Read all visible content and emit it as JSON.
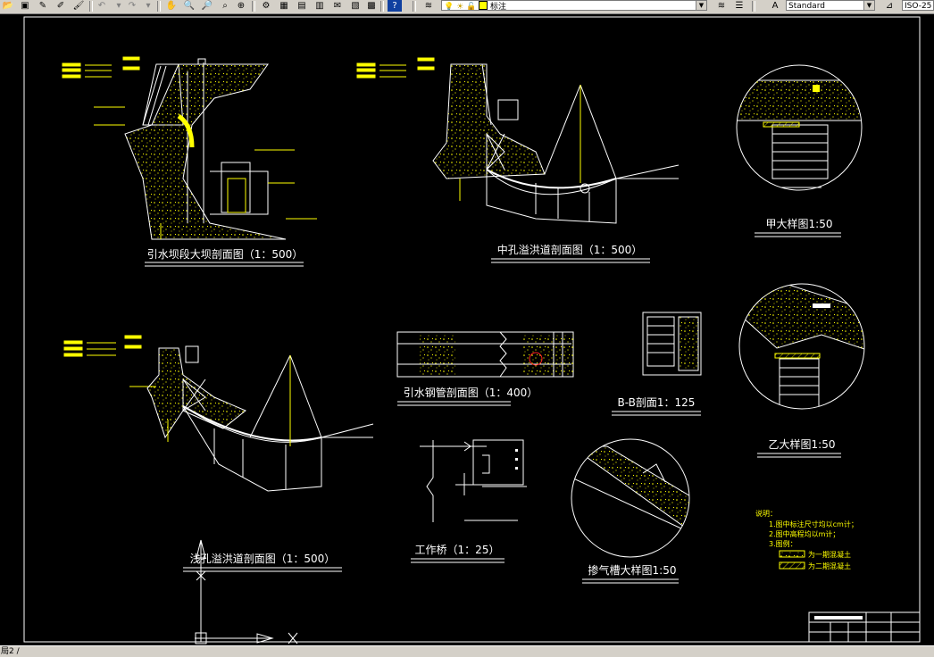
{
  "toolbar": {
    "layer_value": "标注",
    "text_style_value": "Standard",
    "dim_style_value": "ISO-25",
    "icons": [
      "open-icon",
      "save-icon",
      "pencil-icon",
      "match-icon",
      "undo-icon",
      "redo-icon",
      "pan-icon",
      "zoom-realtime-icon",
      "zoom-window-icon",
      "zoom-previous-icon",
      "properties-icon",
      "design-center-icon",
      "tool-palette-icon",
      "sheet-set-icon",
      "markup-icon",
      "calculator-icon",
      "help-icon",
      "layer-manager-icon",
      "lightbulb-icon",
      "sun-icon",
      "lock-icon",
      "color-swatch-icon",
      "layer-previous-icon",
      "layer-states-icon",
      "text-style-icon",
      "dim-style-icon"
    ]
  },
  "drawings": {
    "d1_title": "引水坝段大坝剖面图（1：500）",
    "d2_title": "中孔溢洪道剖面图（1：500）",
    "d3_title": "甲大样图1:50",
    "d4_title": "浅孔溢洪道剖面图（1：500）",
    "d5_title": "引水钢管剖面图（1：400）",
    "d6_title": "B-B剖面1：125",
    "d7_title": "乙大样图1:50",
    "d8_title": "工作桥（1：25）",
    "d9_title": "掺气槽大样图1:50"
  },
  "notes": {
    "heading": "说明：",
    "line1": "1.图中标注尺寸均以cm计；",
    "line2": "2.图中高程均以m计；",
    "line3": "3.图例：",
    "legend1": "为一期混凝土",
    "legend2": "为二期混凝土"
  },
  "statusbar": {
    "tab_text": "局2 /"
  },
  "colors": {
    "background": "#000000",
    "linework": "#ffffff",
    "annotation": "#ffff00",
    "highlight": "#ff2020",
    "toolbar": "#d4d0c8"
  }
}
